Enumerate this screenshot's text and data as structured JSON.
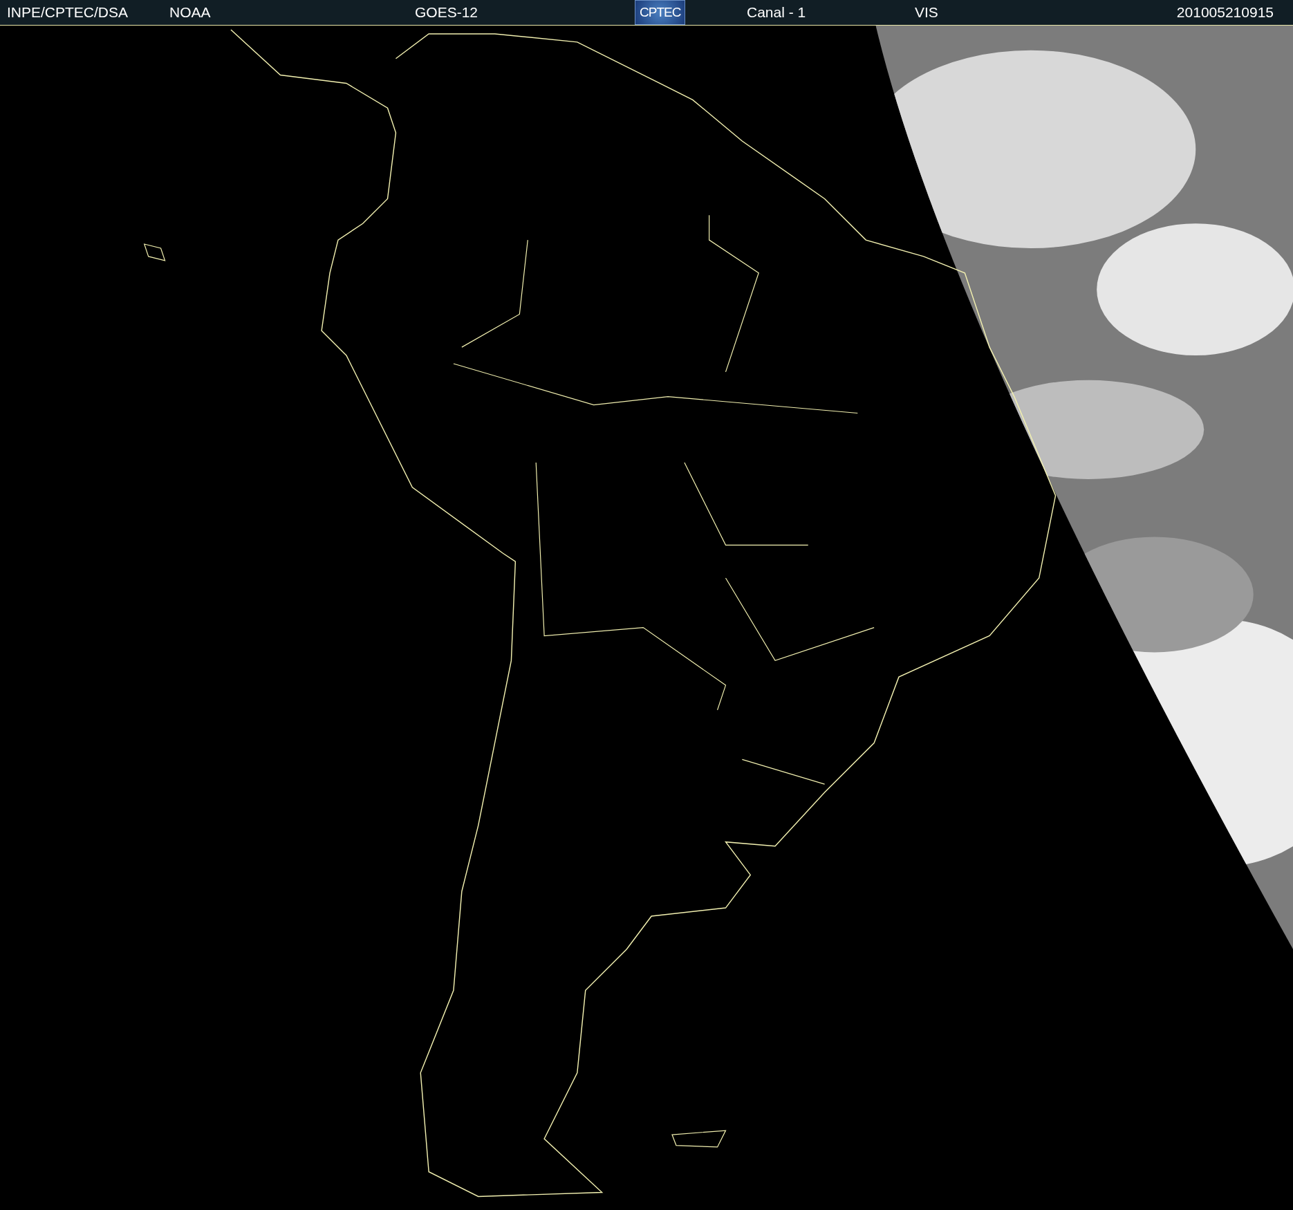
{
  "header": {
    "items": [
      {
        "kind": "text",
        "text": "INPE/CPTEC/DSA"
      },
      {
        "kind": "text",
        "text": "NOAA"
      },
      {
        "kind": "text",
        "text": "GOES-12"
      },
      {
        "kind": "logo",
        "text": "CPTEC"
      },
      {
        "kind": "text",
        "text": "Canal - 1"
      },
      {
        "kind": "text",
        "text": "VIS"
      },
      {
        "kind": "text",
        "text": "201005210915"
      }
    ]
  }
}
